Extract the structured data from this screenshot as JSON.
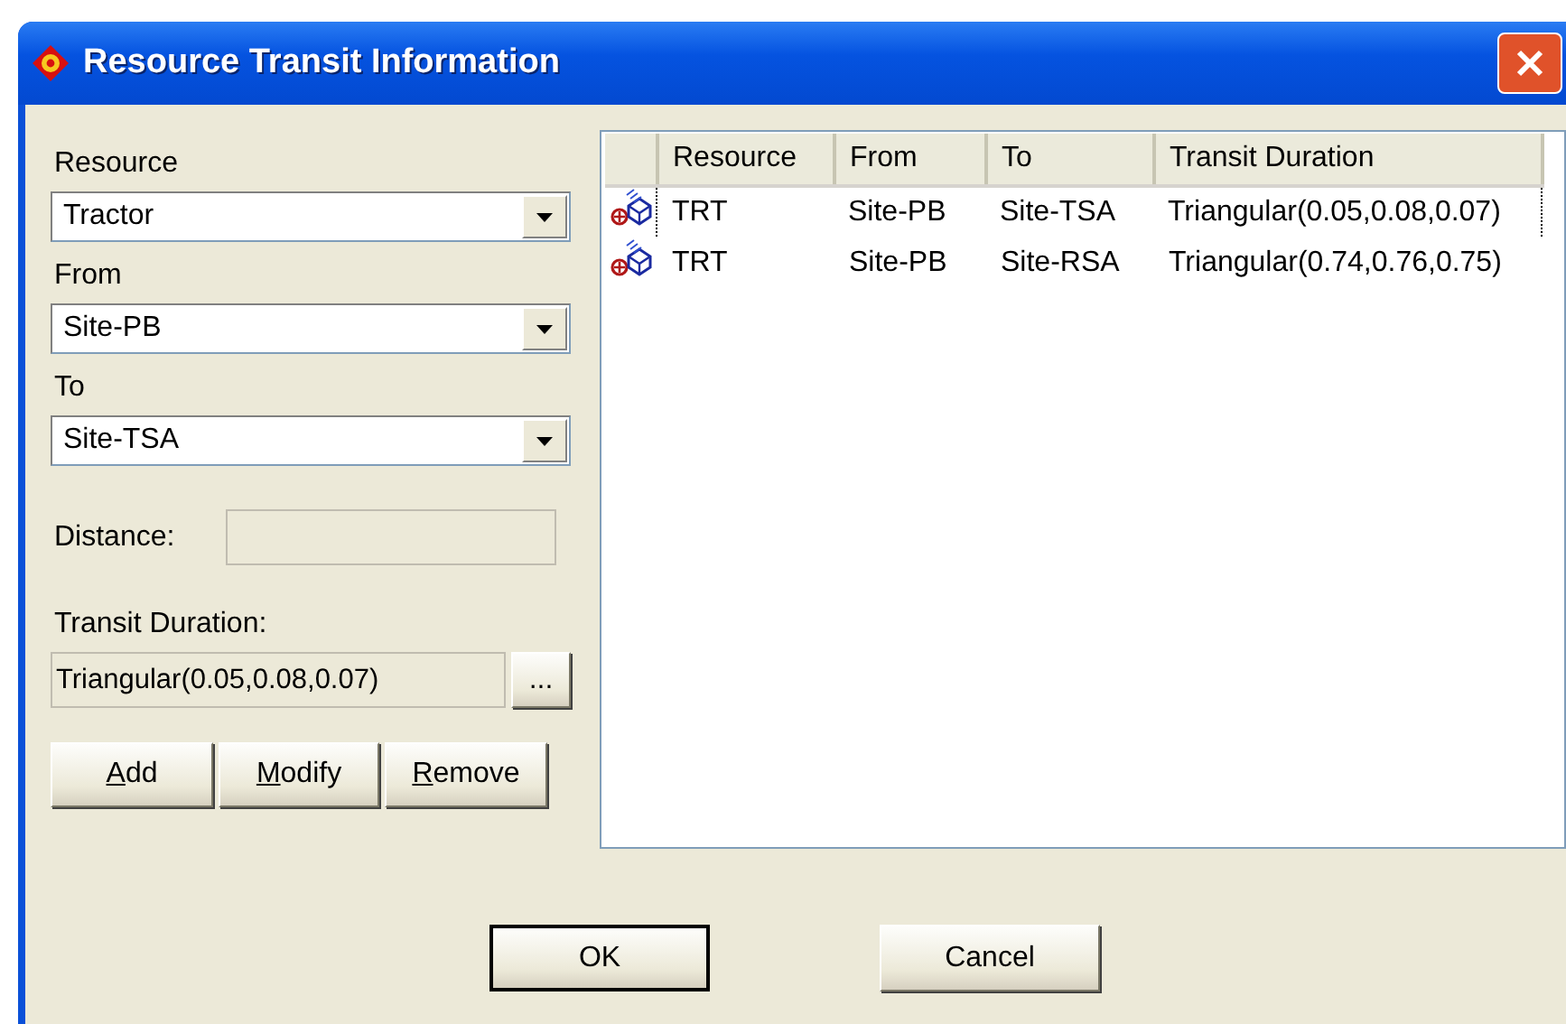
{
  "window": {
    "title": "Resource Transit Information"
  },
  "form": {
    "resource": {
      "label": "Resource",
      "value": "Tractor"
    },
    "from": {
      "label": "From",
      "value": "Site-PB"
    },
    "to": {
      "label": "To",
      "value": "Site-TSA"
    },
    "distance": {
      "label": "Distance:",
      "disabled": true
    },
    "transit_duration": {
      "label": "Transit Duration:",
      "value": "Triangular(0.05,0.08,0.07)",
      "browse": "..."
    }
  },
  "actions": [
    {
      "label": "Add",
      "underline_first": true
    },
    {
      "label": "Modify",
      "underline_first": true
    },
    {
      "label": "Remove",
      "underline_first": true
    }
  ],
  "table": {
    "columns": [
      "Resource",
      "From",
      "To",
      "Transit Duration"
    ],
    "rows": [
      {
        "cells": [
          "TRT",
          "Site-PB",
          "Site-TSA",
          "Triangular(0.05,0.08,0.07)"
        ],
        "focused": true
      },
      {
        "cells": [
          "TRT",
          "Site-PB",
          "Site-RSA",
          "Triangular(0.74,0.76,0.75)"
        ],
        "focused": false
      }
    ]
  },
  "buttons": [
    {
      "label": "OK",
      "default": true
    },
    {
      "label": "Cancel",
      "default": false
    }
  ]
}
